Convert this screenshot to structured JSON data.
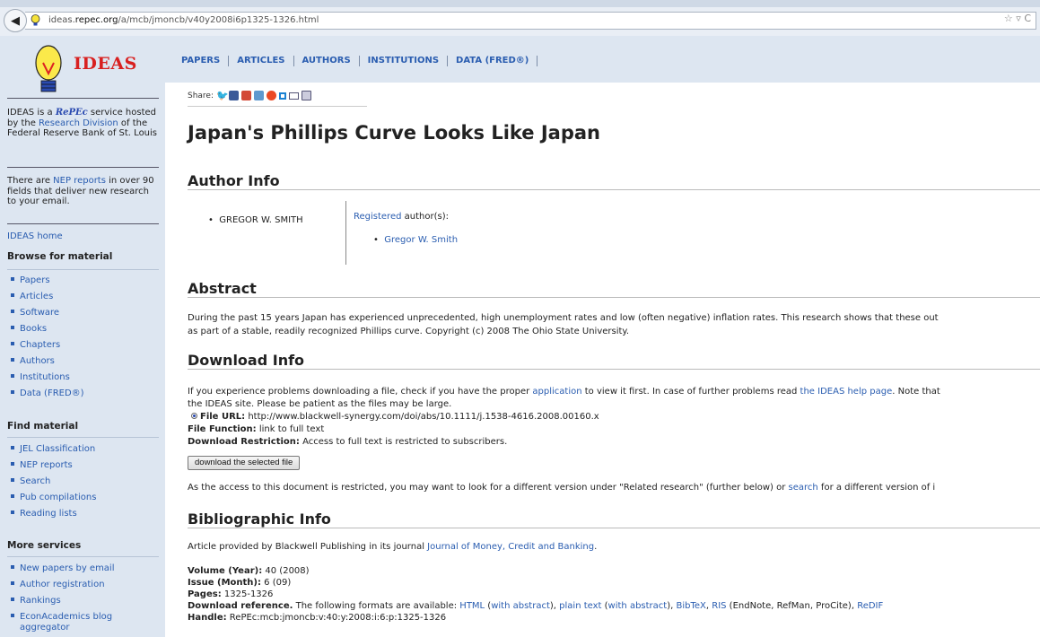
{
  "browser": {
    "url_prefix": "ideas.",
    "url_domain": "repec.org",
    "url_path": "/a/mcb/jmoncb/v40y2008i6p1325-1326.html"
  },
  "brand": {
    "logo_text": "IDEAS",
    "repec": "RePEc"
  },
  "nav": [
    "PAPERS",
    "ARTICLES",
    "AUTHORS",
    "INSTITUTIONS",
    "DATA (FRED®)"
  ],
  "sidebar": {
    "intro_pre": "IDEAS is a ",
    "intro_post": " service hosted by the ",
    "research_division": "Research Division",
    "intro_tail": " of the Federal Reserve Bank of St. Louis",
    "nep_pre": "There are ",
    "nep_link": "NEP reports",
    "nep_post": " in over 90 fields that deliver new research to your email.",
    "home_link": "IDEAS home",
    "browse_heading": "Browse for material",
    "browse_items": [
      "Papers",
      "Articles",
      "Software",
      "Books",
      "Chapters",
      "Authors",
      "Institutions",
      "Data (FRED®)"
    ],
    "find_heading": "Find material",
    "find_items": [
      "JEL Classification",
      "NEP reports",
      "Search",
      "Pub compilations",
      "Reading lists"
    ],
    "more_heading": "More services",
    "more_items": [
      "New papers by email",
      "Author registration",
      "Rankings",
      "EconAcademics blog",
      "aggregator"
    ]
  },
  "share": {
    "label": "Share:"
  },
  "article": {
    "title": "Japan's Phillips Curve Looks Like Japan",
    "author_info_heading": "Author Info",
    "author_plain": "GREGOR W. SMITH",
    "registered_link": "Registered",
    "registered_rest": " author(s):",
    "registered_author": "Gregor W. Smith",
    "abstract_heading": "Abstract",
    "abstract_line1": "During the past 15 years Japan has experienced unprecedented, high unemployment rates and low (often negative) inflation rates. This research shows that these out",
    "abstract_line2": "as part of a stable, readily recognized Phillips curve. Copyright (c) 2008 The Ohio State University.",
    "download_heading": "Download Info",
    "dl_line1_pre": "If you experience problems downloading a file, check if you have the proper ",
    "dl_line1_link1": "application",
    "dl_line1_mid": " to view it first. In case of further problems read ",
    "dl_line1_link2": "the IDEAS help page",
    "dl_line1_post": ". Note that",
    "dl_line2": "the IDEAS site. Please be patient as the files may be large.",
    "file_url_label": "File URL:",
    "file_url": " http://www.blackwell-synergy.com/doi/abs/10.1111/j.1538-4616.2008.00160.x",
    "file_function_label": "File Function:",
    "file_function": " link to full text",
    "restriction_label": "Download Restriction:",
    "restriction": " Access to full text is restricted to subscribers.",
    "download_button": "download the selected file",
    "restricted_pre": "As the access to this document is restricted, you may want to look for a different version under \"Related research\" (further below) or ",
    "restricted_link": "search",
    "restricted_post": " for a different version of i",
    "biblio_heading": "Bibliographic Info",
    "biblio_pre": "Article provided by Blackwell Publishing in its journal ",
    "biblio_journal": "Journal of Money, Credit and Banking",
    "biblio_post": ".",
    "volume_label": "Volume (Year):",
    "volume": " 40 (2008)",
    "issue_label": "Issue (Month):",
    "issue": " 6 (09)",
    "pages_label": "Pages:",
    "pages": " 1325-1326",
    "ref_label": "Download reference.",
    "ref_text": " The following formats are available: ",
    "ref_html": "HTML",
    "ref_with_abstract": "with abstract",
    "ref_plain": "plain text",
    "ref_bibtex": "BibTeX",
    "ref_ris": "RIS",
    "ref_ris_paren": " (EndNote, RefMan, ProCite), ",
    "ref_redif": "ReDIF",
    "handle_label": "Handle:",
    "handle": " RePEc:mcb:jmoncb:v:40:y:2008:i:6:p:1325-1326"
  }
}
